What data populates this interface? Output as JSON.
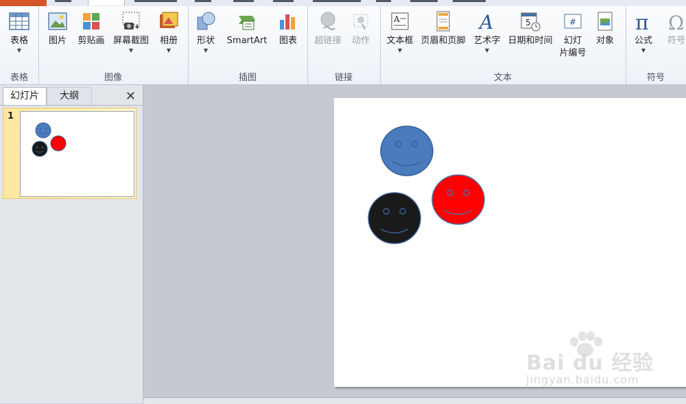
{
  "ribbon": {
    "groups": {
      "table": "表格",
      "images": "图像",
      "illustrations": "插图",
      "links": "链接",
      "text": "文本",
      "symbols": "符号"
    },
    "buttons": {
      "table": "表格",
      "picture": "图片",
      "clipart": "剪贴画",
      "screenshot": "屏幕截图",
      "album": "相册",
      "shapes": "形状",
      "smartart": "SmartArt",
      "chart": "图表",
      "hyperlink": "超链接",
      "action": "动作",
      "textbox": "文本框",
      "header_footer": "页眉和页脚",
      "wordart": "艺术字",
      "datetime": "日期和时间",
      "slide_number_1": "幻灯",
      "slide_number_2": "片编号",
      "object": "对象",
      "equation": "公式",
      "symbol": "符号"
    }
  },
  "left_panel": {
    "tabs": [
      "幻灯片",
      "大纲"
    ],
    "close": "✕",
    "slide_number": "1"
  },
  "slide": {
    "smileys": [
      {
        "name": "blue",
        "color": "#4a7bbd"
      },
      {
        "name": "red",
        "color": "#ff0000"
      },
      {
        "name": "black",
        "color": "#1a1a1a"
      }
    ]
  },
  "watermark": {
    "brand": "Bai du 经验",
    "url": "jingyan.baidu.com"
  }
}
